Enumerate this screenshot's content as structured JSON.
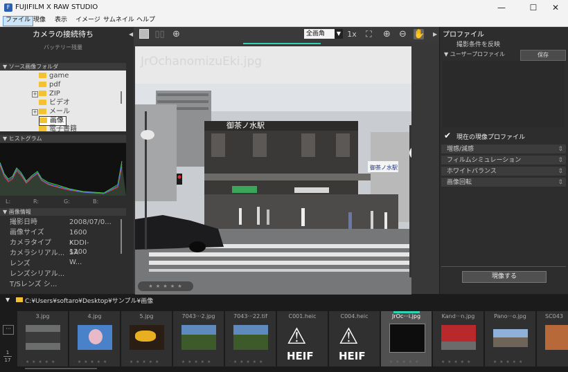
{
  "window": {
    "title": "FUJIFILM X RAW STUDIO",
    "app_icon": "F",
    "minimize": "—",
    "maximize": "☐",
    "close": "✕"
  },
  "menu": [
    "ファイル",
    "現像",
    "表示",
    "イメージ",
    "サムネイル",
    "ヘルプ"
  ],
  "left": {
    "camera_status": "カメラの接続待ち",
    "battery": "バッテリー残量",
    "source_folder_title": "ソース画像フォルダ",
    "folders": [
      "game",
      "pdf",
      "ZIP",
      "ビデオ",
      "メール",
      "画像",
      "電子書籍"
    ],
    "histogram_title": "ヒストグラム",
    "hist_labels": [
      "L:",
      "R:",
      "G:",
      "B:"
    ],
    "image_info_title": "画像情報",
    "info": [
      {
        "k": "撮影日時",
        "v": "2008/07/0..."
      },
      {
        "k": "画像サイズ",
        "v": "1600 x 1200"
      },
      {
        "k": "カメラタイプ",
        "v": "KDDI-SA W..."
      },
      {
        "k": "カメラシリアル...",
        "v": ""
      },
      {
        "k": "レンズ",
        "v": ""
      },
      {
        "k": "レンズシリアル...",
        "v": ""
      },
      {
        "k": "T/Sレンズ シ...",
        "v": ""
      }
    ]
  },
  "viewer": {
    "zoom_select": "全画角",
    "zoom_1x": "1x",
    "filename_overlay": "JrOchanomizuEki.jpg",
    "rating": "★ ★ ★ ★ ★"
  },
  "photo": {
    "station_sign": "御茶ノ水駅",
    "side_sign": "御茶ノ水駅"
  },
  "right": {
    "profile_title": "プロファイル",
    "reflect_conditions": "撮影条件を反映",
    "user_profile": "ユーザープロファイル",
    "save": "保存",
    "current_profile": "現在の現像プロファイル",
    "settings": [
      "増感/減感",
      "フィルムシミュレーション",
      "ホワイトバランス",
      "画像回転"
    ],
    "develop": "現像する"
  },
  "path": "C:¥Users¥softaro¥Desktop¥サンプル¥画像",
  "filmstrip": {
    "counter": "1",
    "total": "17",
    "thumbs": [
      "3.jpg",
      "4.jpg",
      "5.jpg",
      "7043···2.jpg",
      "7043···22.tif",
      "C001.heic",
      "C004.heic",
      "JrOc···i.jpg",
      "Kand···n.jpg",
      "Pano···o.jpg",
      "SC043"
    ],
    "heif": "HEIF",
    "stars": "· ★ ★ ★ ★ ★"
  }
}
